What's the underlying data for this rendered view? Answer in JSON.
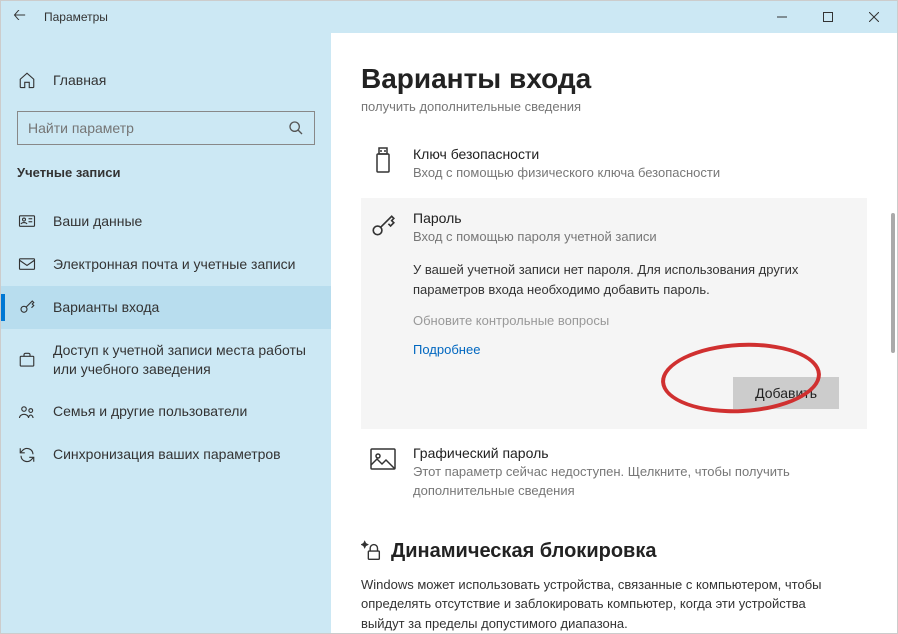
{
  "titlebar": {
    "title": "Параметры"
  },
  "sidebar": {
    "home_label": "Главная",
    "search_placeholder": "Найти параметр",
    "section_header": "Учетные записи",
    "items": [
      {
        "label": "Ваши данные"
      },
      {
        "label": "Электронная почта и учетные записи"
      },
      {
        "label": "Варианты входа"
      },
      {
        "label": "Доступ к учетной записи места работы или учебного заведения"
      },
      {
        "label": "Семья и другие пользователи"
      },
      {
        "label": "Синхронизация ваших параметров"
      }
    ]
  },
  "main": {
    "title": "Варианты входа",
    "subtitle": "получить дополнительные сведения",
    "options": {
      "security_key": {
        "title": "Ключ безопасности",
        "desc": "Вход с помощью физического ключа безопасности"
      },
      "password": {
        "title": "Пароль",
        "desc": "Вход с помощью пароля учетной записи",
        "detail": "У вашей учетной записи нет пароля. Для использования других параметров входа необходимо добавить пароль.",
        "disabled_text": "Обновите контрольные вопросы",
        "link": "Подробнее",
        "button": "Добавить"
      },
      "picture_password": {
        "title": "Графический пароль",
        "desc": "Этот параметр сейчас недоступен. Щелкните, чтобы получить дополнительные сведения"
      }
    },
    "dynamic_lock": {
      "title": "Динамическая блокировка",
      "desc": "Windows может использовать устройства, связанные с компьютером, чтобы определять отсутствие и заблокировать компьютер, когда эти устройства выйдут за пределы допустимого диапазона."
    }
  }
}
